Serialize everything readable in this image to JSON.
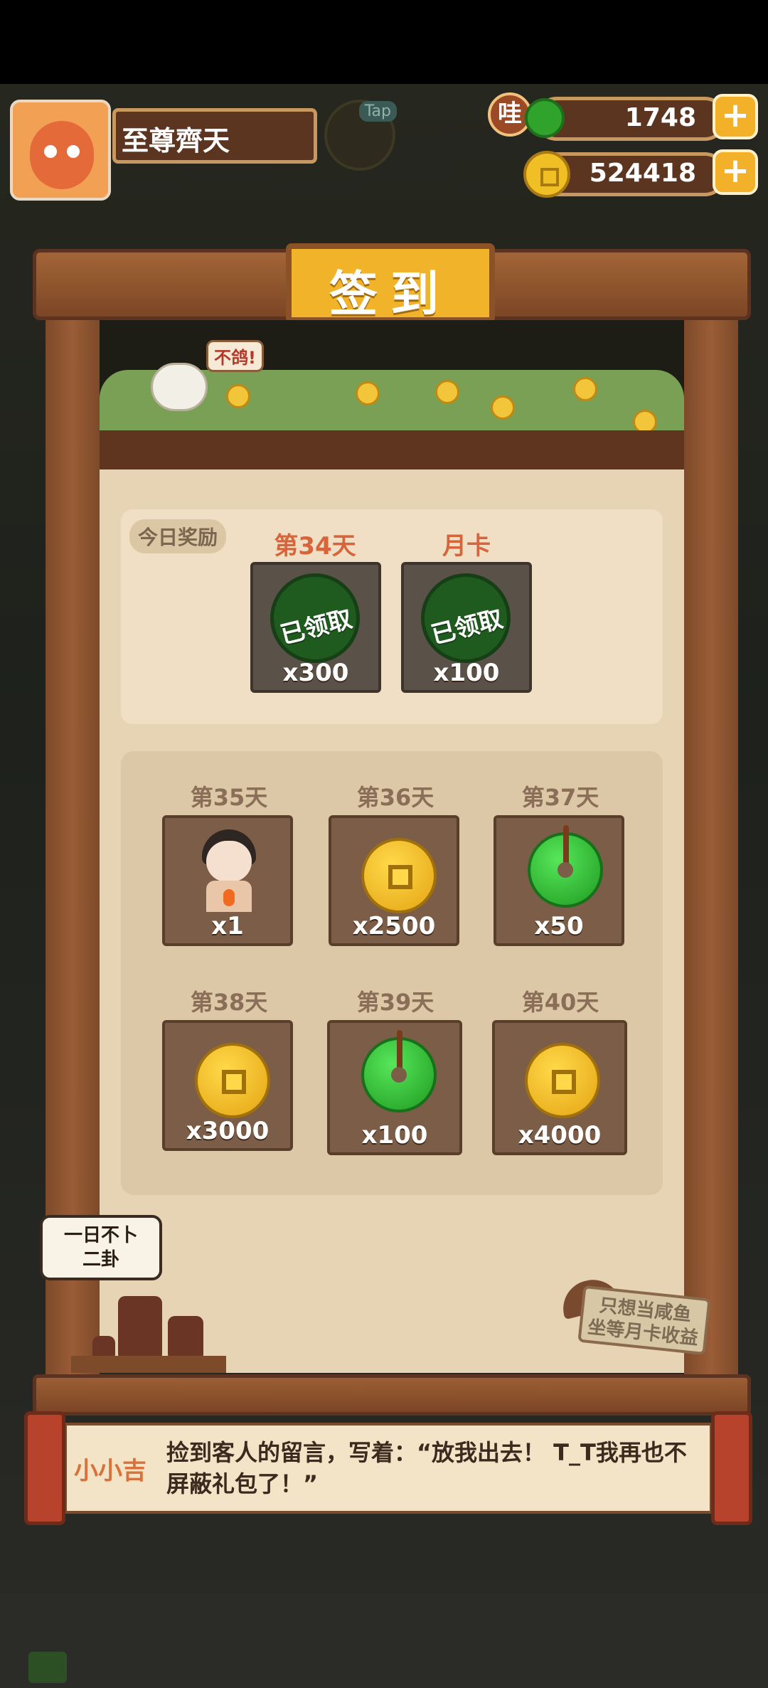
{
  "header": {
    "player_name": "至尊齊天",
    "tap_badge": "Tap",
    "wa_badge": "哇",
    "jade_amount": "1748",
    "coin_amount": "524418",
    "plus_label": "+"
  },
  "signin": {
    "title": "签到",
    "bird_bubble": "不鸽!",
    "today": {
      "tag": "今日奖励",
      "cards": [
        {
          "header": "第34天",
          "status": "已领取",
          "qty": "x300",
          "item": "jade"
        },
        {
          "header": "月卡",
          "status": "已领取",
          "qty": "x100",
          "item": "jade"
        }
      ]
    },
    "upcoming": [
      {
        "day": "第35天",
        "qty": "x1",
        "item": "character"
      },
      {
        "day": "第36天",
        "qty": "x2500",
        "item": "coin"
      },
      {
        "day": "第37天",
        "qty": "x50",
        "item": "jade"
      },
      {
        "day": "第38天",
        "qty": "x3000",
        "item": "coin"
      },
      {
        "day": "第39天",
        "qty": "x100",
        "item": "jade"
      },
      {
        "day": "第40天",
        "qty": "x4000",
        "item": "coin"
      }
    ]
  },
  "decor": {
    "fortune_bubble_line1": "一日不卜",
    "fortune_bubble_line2": "二卦",
    "sign_line1": "只想当咸鱼",
    "sign_line2": "坐等月卡收益"
  },
  "dialog": {
    "speaker": "小小吉",
    "text": "捡到客人的留言，写着：“放我出去！ T_T我再也不屏蔽礼包了！”"
  },
  "colors": {
    "wood": "#7d4a2a",
    "gold": "#f0b329",
    "panel": "#e7d4b4",
    "accent_orange": "#d6653c"
  }
}
